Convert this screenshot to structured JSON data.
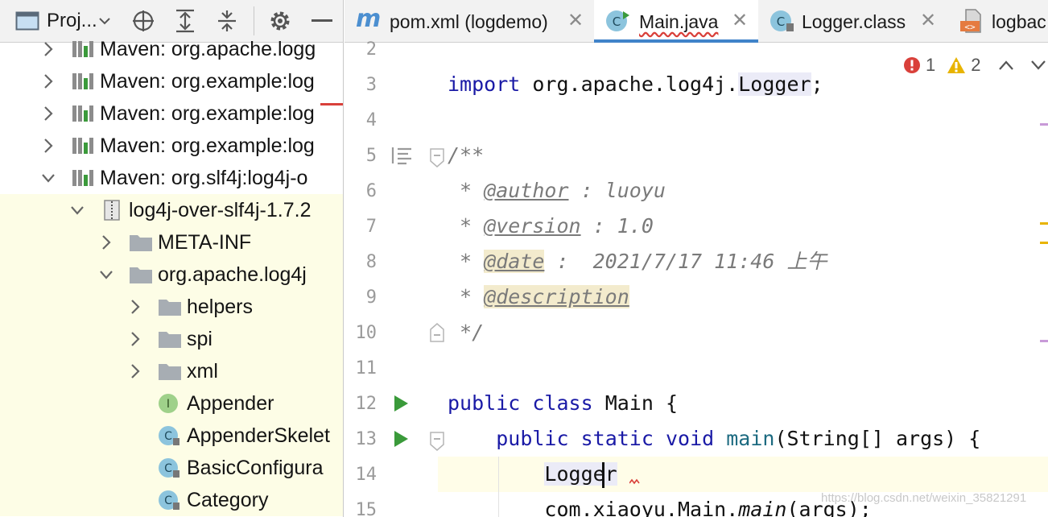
{
  "project_panel": {
    "title": "Proj...",
    "tree": [
      {
        "label": "Maven: org.apache.logg",
        "expanded": false,
        "icon": "library-icon"
      },
      {
        "label": "Maven: org.example:log",
        "expanded": false,
        "icon": "library-icon"
      },
      {
        "label": "Maven: org.example:log",
        "expanded": false,
        "icon": "library-icon"
      },
      {
        "label": "Maven: org.example:log",
        "expanded": false,
        "icon": "library-icon"
      },
      {
        "label": "Maven: org.slf4j:log4j-o",
        "expanded": true,
        "icon": "library-icon"
      },
      {
        "label": "log4j-over-slf4j-1.7.2",
        "expanded": true,
        "icon": "jar-icon"
      },
      {
        "label": "META-INF",
        "expanded": false,
        "icon": "folder-icon"
      },
      {
        "label": "org.apache.log4j",
        "expanded": true,
        "icon": "package-icon"
      },
      {
        "label": "helpers",
        "expanded": false,
        "icon": "folder-icon"
      },
      {
        "label": "spi",
        "expanded": false,
        "icon": "folder-icon"
      },
      {
        "label": "xml",
        "expanded": false,
        "icon": "folder-icon"
      },
      {
        "label": "Appender",
        "icon": "interface-icon",
        "badge": "I"
      },
      {
        "label": "AppenderSkelet",
        "icon": "class-icon",
        "badge": "C"
      },
      {
        "label": "BasicConfigura",
        "icon": "class-icon",
        "badge": "C"
      },
      {
        "label": "Category",
        "icon": "class-icon",
        "badge": "C"
      }
    ]
  },
  "tabs": [
    {
      "label": "pom.xml (logdemo)",
      "icon": "maven-icon",
      "icon_glyph": "m",
      "active": false
    },
    {
      "label": "Main.java",
      "icon": "java-class-icon",
      "icon_glyph": "C",
      "active": true
    },
    {
      "label": "Logger.class",
      "icon": "compiled-class-icon",
      "icon_glyph": "C",
      "active": false
    },
    {
      "label": "logbac",
      "icon": "xml-file-icon",
      "icon_glyph": "<>",
      "active": false
    }
  ],
  "inspections": {
    "errors": "1",
    "warnings": "2"
  },
  "editor": {
    "line_numbers": [
      "2",
      "3",
      "4",
      "5",
      "6",
      "7",
      "8",
      "9",
      "10",
      "11",
      "12",
      "13",
      "14",
      "15"
    ],
    "code": {
      "l3_kw": "import",
      "l3_rest": " org.apache.log4j.",
      "l3_ref": "Logger",
      "l3_end": ";",
      "l5": "/**",
      "l6_star": " * ",
      "l6_tag": "@author",
      "l6_rest": " : luoyu",
      "l7_star": " * ",
      "l7_tag": "@version",
      "l7_rest": " : 1.0",
      "l8_star": " * ",
      "l8_tag": "@date",
      "l8_rest": " :  2021/7/17 11:46 上午",
      "l9_star": " * ",
      "l9_tag": "@description",
      "l10": " */",
      "l12_kw1": "public",
      "l12_kw2": "class",
      "l12_rest": " Main {",
      "l13_kw1": "public",
      "l13_kw2": "static",
      "l13_kw3": "void",
      "l13_method": "main",
      "l13_rest": "(String[] args) {",
      "l14_ref": "Logger",
      "l15_pre": "com.xiaoyu.Main.",
      "l15_method": "main",
      "l15_rest": "(args);"
    }
  },
  "watermark": "https://blog.csdn.net/weixin_35821291",
  "colors": {
    "keyword": "#1a1aa6",
    "comment": "#7a7a7a",
    "accent": "#4083c9",
    "error": "#d9403a",
    "warning": "#e8b400",
    "run": "#3a9a3a"
  }
}
